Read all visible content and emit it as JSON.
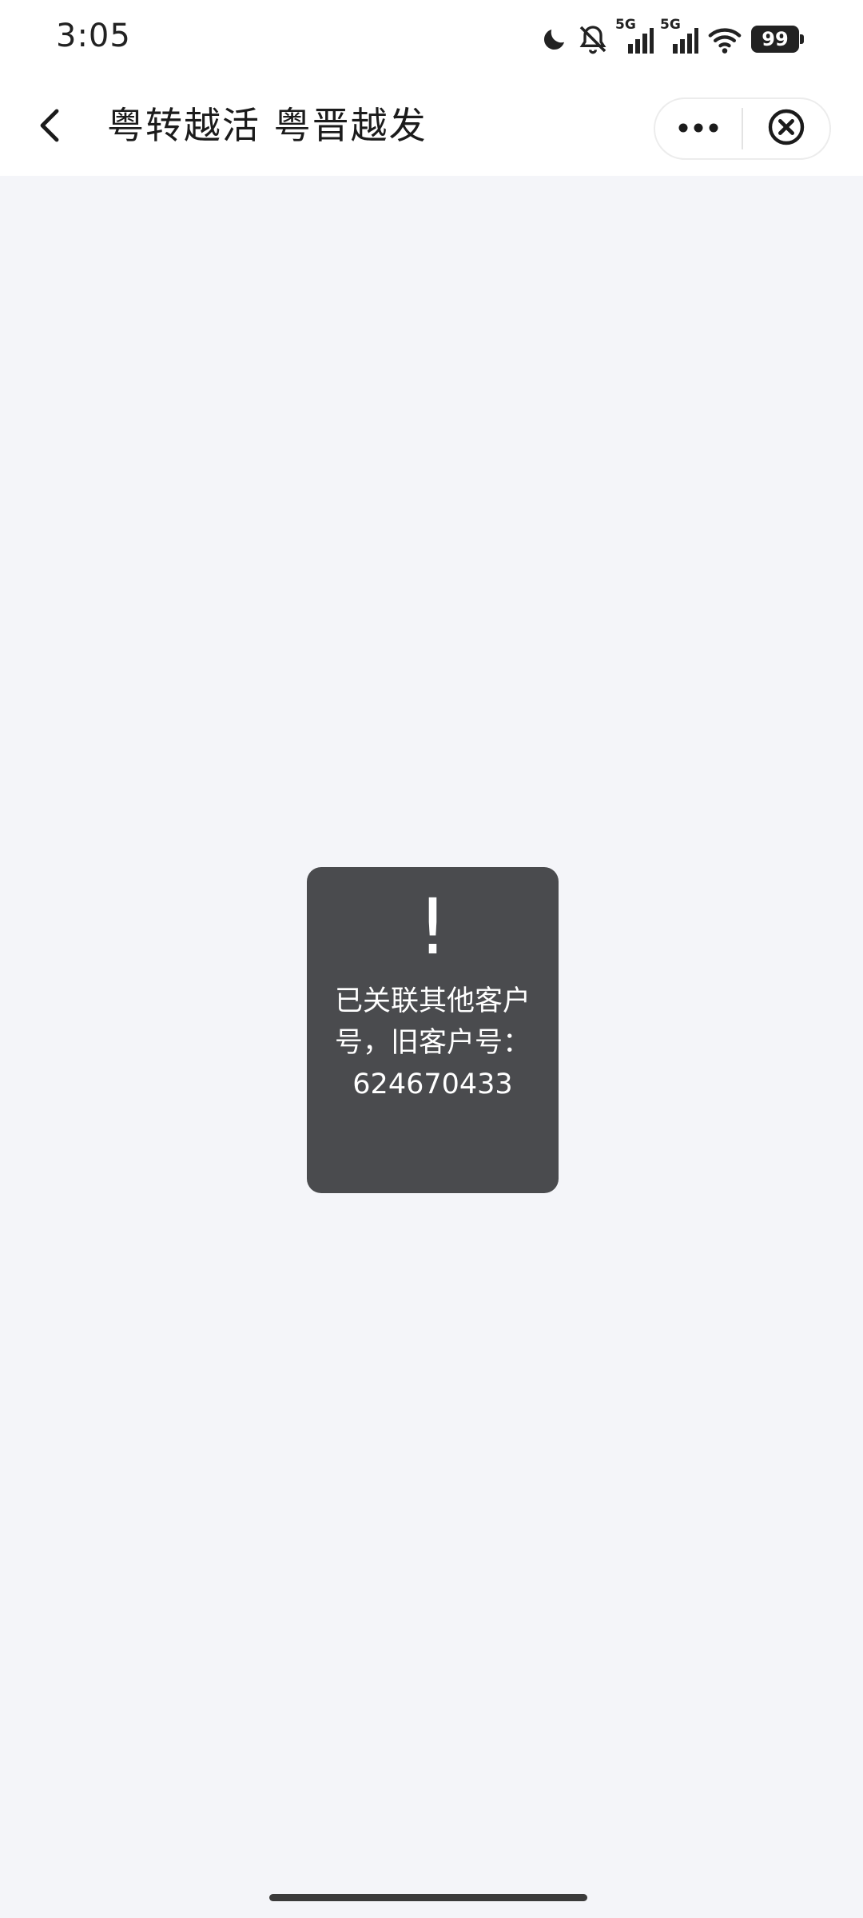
{
  "status_bar": {
    "time": "3:05",
    "network_1": "5G",
    "network_2": "5G",
    "battery_level": "99",
    "icons": [
      "moon-icon",
      "bell-muted-icon",
      "signal-icon",
      "signal-icon",
      "wifi-icon",
      "battery-icon"
    ]
  },
  "nav": {
    "title": "粤转越活 粤晋越发",
    "back_icon": "chevron-left-icon",
    "more_icon": "more-dots-icon",
    "close_icon": "close-circle-icon"
  },
  "toast": {
    "icon": "!",
    "message": "已关联其他客户号，旧客户号：624670433"
  },
  "colors": {
    "background": "#f4f5f9",
    "toast_bg": "#4a4b4e",
    "bar_bg": "#ffffff"
  }
}
